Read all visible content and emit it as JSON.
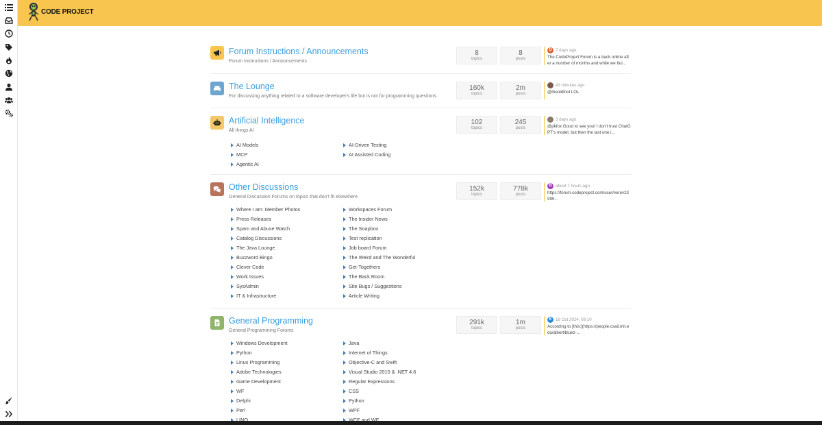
{
  "header": {
    "logo_text": "CODE PROJECT"
  },
  "sidebar": {
    "top_icons": [
      "list-icon",
      "inbox-icon",
      "clock-icon",
      "tags-icon",
      "fire-icon",
      "globe-icon",
      "user-icon",
      "users-icon",
      "cogs-icon"
    ],
    "bottom_icons": [
      "brush-icon",
      "expand-icon"
    ]
  },
  "categories": [
    {
      "name": "forum-instructions",
      "title": "Forum Instructions / Announcements",
      "description": "Forum Instructions / Announcements",
      "icon": "bullhorn-icon",
      "icon_color": "#f8c54f",
      "topics": "8",
      "topics_label": "topics",
      "posts": "8",
      "posts_label": "posts",
      "teaser": {
        "avatar_letter": "D",
        "avatar_color": "#e0632e",
        "time": "7 days ago",
        "text": "The CodeProject Forum is a back online after a number of months and while we bui..."
      },
      "subforums_left": [],
      "subforums_right": []
    },
    {
      "name": "the-lounge",
      "title": "The Lounge",
      "description": "For discussing anything related to a software developer's life but is not for programming questions.",
      "icon": "couch-icon",
      "icon_color": "#6fa6d0",
      "topics": "160k",
      "topics_label": "topics",
      "posts": "2m",
      "posts_label": "posts",
      "teaser": {
        "avatar_letter": "",
        "avatar_color": "#7a5a4a",
        "time": "43 minutes ago",
        "text": "@theoldfool LOL."
      },
      "subforums_left": [],
      "subforums_right": []
    },
    {
      "name": "artificial-intelligence",
      "title": "Artificial Intelligence",
      "description": "All things AI",
      "icon": "robot-icon",
      "icon_color": "#f3c76a",
      "topics": "102",
      "topics_label": "topics",
      "posts": "245",
      "posts_label": "posts",
      "teaser": {
        "avatar_letter": "",
        "avatar_color": "#8a7a6a",
        "time": "3 days ago",
        "text": "@pkfox Good to see you! I don't trust ChatGPT's model, but then the last one i..."
      },
      "subforums_left": [
        "AI Models",
        "MCP",
        "Agentic AI"
      ],
      "subforums_right": [
        "AI-Driven Testing",
        "AI Assisted Coding"
      ]
    },
    {
      "name": "other-discussions",
      "title": "Other Discussions",
      "description": "General Discussion Forums on topics that don't fit elsewhere",
      "icon": "comments-icon",
      "icon_color": "#b8735a",
      "topics": "152k",
      "topics_label": "topics",
      "posts": "778k",
      "posts_label": "posts",
      "teaser": {
        "avatar_letter": "B",
        "avatar_color": "#9b3fb5",
        "time": "about 7 hours ago",
        "text": "https://forum.codeproject.com/user/verev23995..."
      },
      "subforums_left": [
        "Where I am: Member Photos",
        "Press Releases",
        "Spam and Abuse Watch",
        "Catalog Discussions",
        "The Java Lounge",
        "Buzzword Bingo",
        "Clever Code",
        "Work Issues",
        "SysAdmin",
        "IT & Infrastructure"
      ],
      "subforums_right": [
        "Workspaces Forum",
        "The Insider News",
        "The Soapbox",
        "Test replication",
        "Job board Forum",
        "The Weird and The Wonderful",
        "Get-Togethers",
        "The Back Room",
        "Site Bugs / Suggestions",
        "Article Writing"
      ]
    },
    {
      "name": "general-programming",
      "title": "General Programming",
      "description": "General Programming Forums",
      "icon": "code-file-icon",
      "icon_color": "#8fb56a",
      "topics": "291k",
      "topics_label": "topics",
      "posts": "1m",
      "posts_label": "posts",
      "teaser": {
        "avatar_letter": "K",
        "avatar_color": "#2e8be0",
        "time": "18 Oct 2024, 09:10",
        "text": "According to [this:](https://people.csail.mit.edu/albert/bluez-..."
      },
      "subforums_left": [
        "Windows Development",
        "Python",
        "Linux Programming",
        "Adobe Technologies",
        "Game Development",
        "WF",
        "Delphi",
        "Perl",
        "LINQ"
      ],
      "subforums_right": [
        "Java",
        "Internet of Things",
        "Objective-C and Swift",
        "Visual Studio 2015 & .NET 4.6",
        "Regular Expressions",
        "CSS",
        "Python",
        "WPF",
        "WCF and WF"
      ]
    }
  ]
}
